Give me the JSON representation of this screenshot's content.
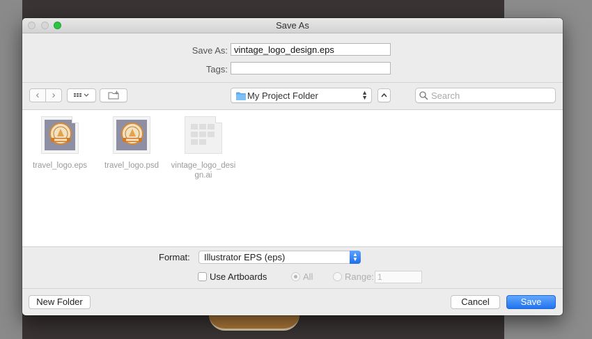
{
  "window": {
    "title": "Save As"
  },
  "form": {
    "save_as_label": "Save As:",
    "save_as_value": "vintage_logo_design.eps",
    "tags_label": "Tags:",
    "tags_value": ""
  },
  "toolbar": {
    "back_symbol": "‹",
    "forward_symbol": "›",
    "location": "My Project Folder",
    "search_placeholder": "Search"
  },
  "files": [
    {
      "name": "travel_logo.eps",
      "icon": "image-thumbnail-icon",
      "selectable": true
    },
    {
      "name": "travel_logo.psd",
      "icon": "image-thumbnail-icon",
      "selectable": true
    },
    {
      "name": "vintage_logo_design.ai",
      "icon": "document-thumbnail-icon",
      "selectable": false
    }
  ],
  "options": {
    "format_label": "Format:",
    "format_value": "Illustrator EPS (eps)",
    "use_artboards_label": "Use Artboards",
    "use_artboards_checked": false,
    "all_label": "All",
    "range_label": "Range:",
    "range_value": "1"
  },
  "buttons": {
    "new_folder": "New Folder",
    "cancel": "Cancel",
    "save": "Save"
  },
  "colors": {
    "accent": "#2172f0",
    "close_light": "#d6d6d6",
    "zoom_light": "#2dc441",
    "folder_icon": "#5aaaf0"
  }
}
